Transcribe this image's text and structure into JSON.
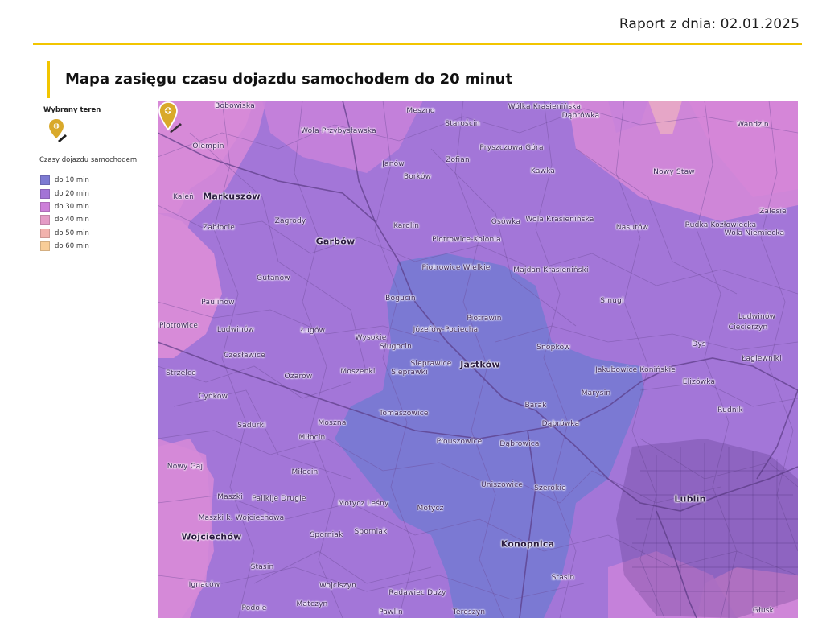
{
  "header": {
    "report_date": "Raport z dnia: 02.01.2025"
  },
  "title": "Mapa zasięgu czasu dojazdu samochodem do 20 minut",
  "legend": {
    "selected_area_title": "Wybrany teren",
    "travel_times_title": "Czasy dojazdu samochodem",
    "items": [
      {
        "label": "do 10 min",
        "color": "#7d7ad2"
      },
      {
        "label": "do 20 min",
        "color": "#a374d6"
      },
      {
        "label": "do 30 min",
        "color": "#cd7fd9"
      },
      {
        "label": "do 40 min",
        "color": "#e49bc6"
      },
      {
        "label": "do 50 min",
        "color": "#f2b2ad"
      },
      {
        "label": "do 60 min",
        "color": "#f8cd98"
      }
    ],
    "pin_color": "#d9a92a"
  },
  "map": {
    "places": [
      {
        "name": "Bobowiska",
        "major": false
      },
      {
        "name": "Meszno",
        "major": false
      },
      {
        "name": "Wólka Krasienińska",
        "major": false
      },
      {
        "name": "Dąbrówka",
        "major": false
      },
      {
        "name": "Wandzin",
        "major": false
      },
      {
        "name": "Wola Przybysławska",
        "major": false
      },
      {
        "name": "Starościn",
        "major": false
      },
      {
        "name": "Olempin",
        "major": false
      },
      {
        "name": "Pryszczowa Góra",
        "major": false
      },
      {
        "name": "Zofian",
        "major": false
      },
      {
        "name": "Janów",
        "major": false
      },
      {
        "name": "Kawka",
        "major": false
      },
      {
        "name": "Nowy Staw",
        "major": false
      },
      {
        "name": "Borków",
        "major": false
      },
      {
        "name": "Kaleń",
        "major": false
      },
      {
        "name": "Markuszów",
        "major": true
      },
      {
        "name": "Zalesie",
        "major": false
      },
      {
        "name": "Zagrody",
        "major": false
      },
      {
        "name": "Osówka",
        "major": false
      },
      {
        "name": "Wola Krasienińska",
        "major": false
      },
      {
        "name": "Rudka Kozłowiecka",
        "major": false
      },
      {
        "name": "Zabłocie",
        "major": false
      },
      {
        "name": "Karolin",
        "major": false
      },
      {
        "name": "Nasutów",
        "major": false
      },
      {
        "name": "Wola Niemiecka",
        "major": false
      },
      {
        "name": "Garbów",
        "major": true
      },
      {
        "name": "Piotrowice-Kolonia",
        "major": false
      },
      {
        "name": "Piotrowice Wielkie",
        "major": false
      },
      {
        "name": "Majdan Krasieniński",
        "major": false
      },
      {
        "name": "Gutanów",
        "major": false
      },
      {
        "name": "Bogucin",
        "major": false
      },
      {
        "name": "Smugi",
        "major": false
      },
      {
        "name": "Paulinów",
        "major": false
      },
      {
        "name": "Piotrawin",
        "major": false
      },
      {
        "name": "Ludwinów",
        "major": false
      },
      {
        "name": "Piotrowice",
        "major": false
      },
      {
        "name": "Ludwinów",
        "major": false
      },
      {
        "name": "Ługów",
        "major": false
      },
      {
        "name": "Józefów-Pociecha",
        "major": false
      },
      {
        "name": "Ciecierzyn",
        "major": false
      },
      {
        "name": "Wysokie",
        "major": false
      },
      {
        "name": "Dys",
        "major": false
      },
      {
        "name": "Snopków",
        "major": false
      },
      {
        "name": "Sługocin",
        "major": false
      },
      {
        "name": "Czesławice",
        "major": false
      },
      {
        "name": "Łagiewniki",
        "major": false
      },
      {
        "name": "Sieprawice",
        "major": false
      },
      {
        "name": "Jastków",
        "major": true
      },
      {
        "name": "Strzelce",
        "major": false
      },
      {
        "name": "Moszenki",
        "major": false
      },
      {
        "name": "Sieprawki",
        "major": false
      },
      {
        "name": "Jakubowice Konińskie",
        "major": false
      },
      {
        "name": "Ożarów",
        "major": false
      },
      {
        "name": "Elizówka",
        "major": false
      },
      {
        "name": "Marysin",
        "major": false
      },
      {
        "name": "Cyńków",
        "major": false
      },
      {
        "name": "Barak",
        "major": false
      },
      {
        "name": "Rudnik",
        "major": false
      },
      {
        "name": "Tomaszowice",
        "major": false
      },
      {
        "name": "Dąbrówka",
        "major": false
      },
      {
        "name": "Sadurki",
        "major": false
      },
      {
        "name": "Moszna",
        "major": false
      },
      {
        "name": "Miłocin",
        "major": false
      },
      {
        "name": "Płouszowice",
        "major": false
      },
      {
        "name": "Dąbrowica",
        "major": false
      },
      {
        "name": "Nowy Gaj",
        "major": false
      },
      {
        "name": "Miłocin",
        "major": false
      },
      {
        "name": "Uniszowice",
        "major": false
      },
      {
        "name": "Szerokie",
        "major": false
      },
      {
        "name": "Maszki",
        "major": false
      },
      {
        "name": "Palikije Drugie",
        "major": false
      },
      {
        "name": "Motycz Leśny",
        "major": false
      },
      {
        "name": "Lublin",
        "major": true
      },
      {
        "name": "Motycz",
        "major": false
      },
      {
        "name": "Maszki k. Wojciechowa",
        "major": false
      },
      {
        "name": "Wojciechów",
        "major": true
      },
      {
        "name": "Sporniak",
        "major": false
      },
      {
        "name": "Sporniak",
        "major": false
      },
      {
        "name": "Konopnica",
        "major": true
      },
      {
        "name": "Stasin",
        "major": false
      },
      {
        "name": "Stasin",
        "major": false
      },
      {
        "name": "Ignaców",
        "major": false
      },
      {
        "name": "Wojciszyn",
        "major": false
      },
      {
        "name": "Radawiec Duży",
        "major": false
      },
      {
        "name": "Podole",
        "major": false
      },
      {
        "name": "Matczyn",
        "major": false
      },
      {
        "name": "Pawlin",
        "major": false
      },
      {
        "name": "Tereszyn",
        "major": false
      },
      {
        "name": "Głusk",
        "major": false
      }
    ]
  }
}
